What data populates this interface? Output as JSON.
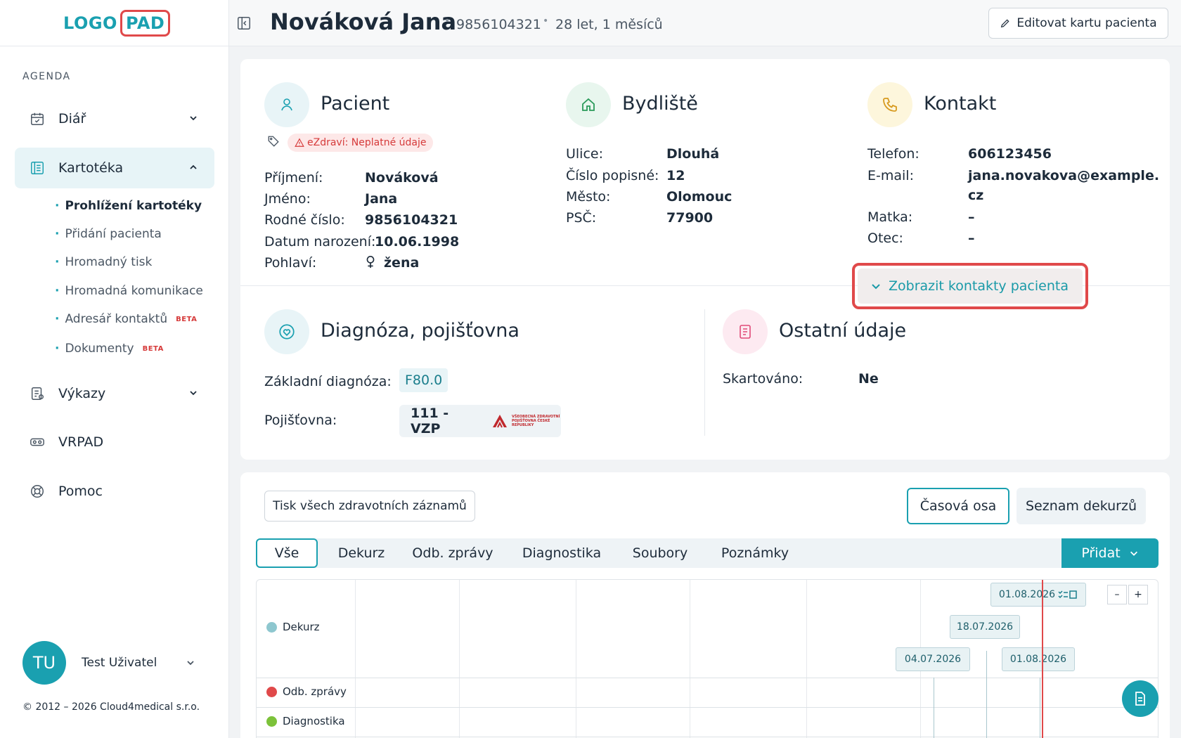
{
  "brand": {
    "logo_left": "LOGO",
    "logo_right": "PAD"
  },
  "sidebar": {
    "section": "AGENDA",
    "items": [
      {
        "label": "Diář"
      },
      {
        "label": "Kartotéka"
      },
      {
        "label": "Výkazy"
      },
      {
        "label": "VRPAD"
      },
      {
        "label": "Pomoc"
      }
    ],
    "subitems": [
      {
        "label": "Prohlížení kartotéky"
      },
      {
        "label": "Přidání pacienta"
      },
      {
        "label": "Hromadný tisk"
      },
      {
        "label": "Hromadná komunikace"
      },
      {
        "label": "Adresář kontaktů",
        "badge": "BETA"
      },
      {
        "label": "Dokumenty",
        "badge": "BETA"
      }
    ]
  },
  "user": {
    "initials": "TU",
    "name": "Test Uživatel"
  },
  "copyright": "© 2012 – 2026 Cloud4medical s.r.o.",
  "header": {
    "name": "Nováková Jana",
    "birth_number": "9856104321",
    "age": "28 let, 1 měsíců",
    "edit_label": "Editovat kartu pacienta"
  },
  "patient": {
    "title": "Pacient",
    "warning": "eZdraví: Neplatné údaje",
    "fields": [
      {
        "label": "Příjmení:",
        "value": "Nováková"
      },
      {
        "label": "Jméno:",
        "value": "Jana"
      },
      {
        "label": "Rodné číslo:",
        "value": "9856104321"
      },
      {
        "label": "Datum narození:",
        "value": "10.06.1998"
      },
      {
        "label": "Pohlaví:",
        "value": "žena"
      }
    ]
  },
  "address": {
    "title": "Bydliště",
    "fields": [
      {
        "label": "Ulice:",
        "value": "Dlouhá"
      },
      {
        "label": "Číslo popisné:",
        "value": "12"
      },
      {
        "label": "Město:",
        "value": "Olomouc"
      },
      {
        "label": "PSČ:",
        "value": "77900"
      }
    ]
  },
  "contact": {
    "title": "Kontakt",
    "fields": [
      {
        "label": "Telefon:",
        "value": "606123456"
      },
      {
        "label": "E-mail:",
        "value": "jana.novakova@example.",
        "value2": "cz"
      },
      {
        "label": "Matka:",
        "value": "–"
      },
      {
        "label": "Otec:",
        "value": "–"
      }
    ],
    "show_label": "Zobrazit kontakty pacienta"
  },
  "diagnosis": {
    "title": "Diagnóza, pojišťovna",
    "base_label": "Základní diagnóza:",
    "base_value": "F80.0",
    "insurance_label": "Pojišťovna:",
    "insurance_value": "111 - VZP",
    "insurance_logo_text": "VŠEOBECNÁ ZDRAVOTNÍ POJIŠŤOVNA ČESKÉ REPUBLIKY"
  },
  "other": {
    "title": "Ostatní údaje",
    "shred_label": "Skartováno:",
    "shred_value": "Ne"
  },
  "records": {
    "print_label": "Tisk všech zdravotních záznamů",
    "view_timeline": "Časová osa",
    "view_list": "Seznam dekurzů",
    "tabs": [
      "Vše",
      "Dekurz",
      "Odb. zprávy",
      "Diagnostika",
      "Soubory",
      "Poznámky"
    ],
    "add_label": "Přidat",
    "rows": [
      {
        "label": "Dekurz",
        "color": "#8ec7cf"
      },
      {
        "label": "Odb. zprávy",
        "color": "#e0494a"
      },
      {
        "label": "Diagnostika",
        "color": "#7cc23a"
      }
    ],
    "dates": [
      "01.08.2026",
      "18.07.2026",
      "04.07.2026",
      "01.08.2026"
    ],
    "zoom_out": "–",
    "zoom_in": "+"
  },
  "colors": {
    "accent": "#1aa0b0",
    "alert": "#e0494a"
  }
}
